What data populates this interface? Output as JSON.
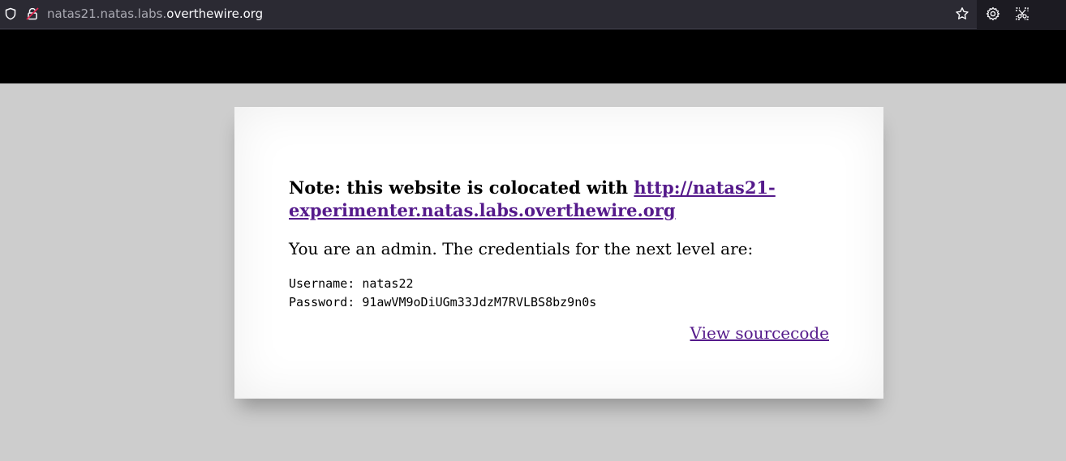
{
  "browser": {
    "url": {
      "prefix": "natas21.natas.labs.",
      "domain": "overthewire.org"
    },
    "icons": {
      "tracking": "shield-icon",
      "security": "lock-icon",
      "bookmark": "star-icon",
      "settings": "gear-icon",
      "screenshot": "screenshot-icon"
    }
  },
  "page": {
    "note_prefix": "Note: this website is colocated with ",
    "note_link": "http://natas21-experimenter.natas.labs.overthewire.org",
    "admin_message": "You are an admin. The credentials for the next level are:",
    "username_label": "Username: ",
    "username": "natas22",
    "password_label": "Password: ",
    "password": "91awVM9oDiUGm33JdzM7RVLBS8bz9n0s",
    "source_link": "View sourcecode"
  },
  "colors": {
    "page_background": "#cdcdcd",
    "banner": "#000000",
    "visited_link": "#551a8b"
  }
}
